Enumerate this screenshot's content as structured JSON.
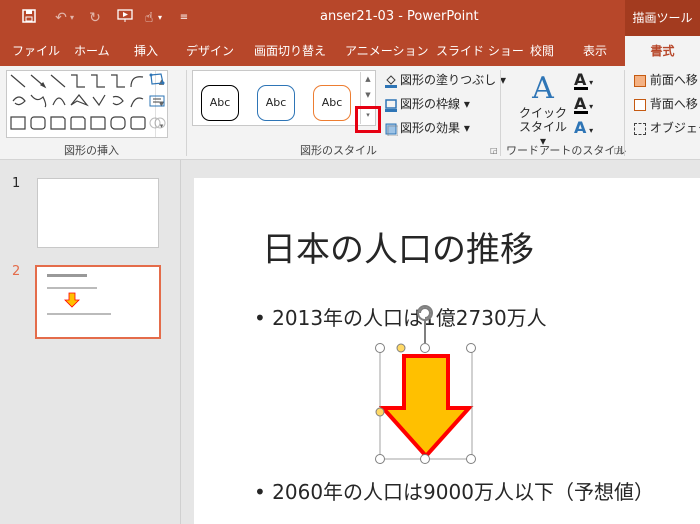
{
  "app": {
    "window_title": "anser21-03 - PowerPoint",
    "context_tab": "描画ツール"
  },
  "tabs": [
    "ファイル",
    "ホーム",
    "挿入",
    "デザイン",
    "画面切り替え",
    "アニメーション",
    "スライド ショー",
    "校閲",
    "表示",
    "書式"
  ],
  "active_tab": "書式",
  "ribbon": {
    "insert_shapes_label": "図形の挿入",
    "shape_styles_label": "図形のスタイル",
    "wordart_label": "ワードアートのスタイル",
    "style_samples": [
      "Abc",
      "Abc",
      "Abc"
    ],
    "fill": "図形の塗りつぶし",
    "outline": "図形の枠線",
    "effects": "図形の効果",
    "quick_style_line1": "クイック",
    "quick_style_line2": "スタイル",
    "bring_forward": "前面へ移",
    "send_backward": "背面へ移",
    "selection_pane": "オブジェクト"
  },
  "slides_panel": {
    "thumb1_num": "1",
    "thumb2_num": "2"
  },
  "slide": {
    "title": "日本の人口の推移",
    "bullet1": "• 2013年の人口は1億2730万人",
    "bullet2": "• 2060年の人口は9000万人以下（予想値）"
  },
  "colors": {
    "accent": "#b7472a",
    "highlight": "#e60012",
    "arrow_fill": "#ffc000",
    "arrow_outline": "#ff0000"
  }
}
